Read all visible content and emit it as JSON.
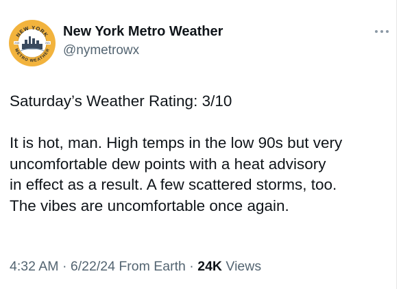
{
  "author": {
    "display_name": "New York Metro Weather",
    "handle": "@nymetrowx",
    "avatar_text_top": "NEW YORK",
    "avatar_text_bottom": "METRO WEATHER",
    "avatar_year_left": "2015",
    "avatar_year_right": "2021"
  },
  "tweet": {
    "rating_line": "Saturday’s Weather Rating: 3/10",
    "body": "It is hot, man. High temps in the low 90s but very\nuncomfortable dew points with a heat advisory\nin effect as a result. A few scattered storms, too.\nThe vibes are uncomfortable once again."
  },
  "meta": {
    "time": "4:32 AM",
    "separator": " · ",
    "date": "6/22/24",
    "source": " From Earth",
    "views_count": "24K",
    "views_label": " Views"
  },
  "icons": {
    "more": "more-horizontal-icon"
  },
  "colors": {
    "text_primary": "#0f1419",
    "text_secondary": "#536471",
    "avatar_ring": "#f2b33d"
  }
}
